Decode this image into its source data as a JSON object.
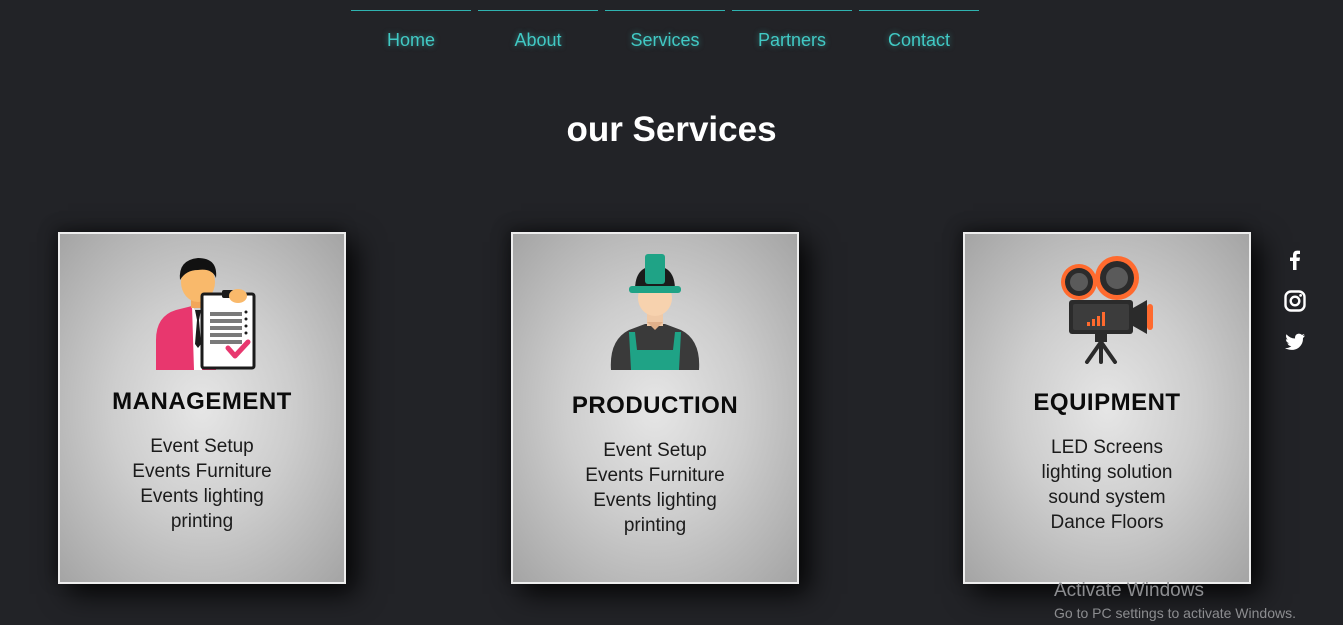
{
  "nav": {
    "items": [
      "Home",
      "About",
      "Services",
      "Partners",
      "Contact"
    ]
  },
  "page_title": "our Services",
  "cards": [
    {
      "icon": "manager-icon",
      "heading": "MANAGEMENT",
      "items": [
        "Event Setup",
        "Events Furniture",
        "Events lighting",
        "printing"
      ]
    },
    {
      "icon": "worker-icon",
      "heading": "PRODUCTION",
      "items": [
        "Event Setup",
        "Events Furniture",
        "Events lighting",
        "printing"
      ]
    },
    {
      "icon": "video-camera-icon",
      "heading": "EQUIPMENT",
      "items": [
        "LED Screens",
        "lighting solution",
        "sound system",
        "Dance Floors"
      ]
    }
  ],
  "social": [
    "facebook-icon",
    "instagram-icon",
    "twitter-icon"
  ],
  "watermark": {
    "title": "Activate Windows",
    "subtitle": "Go to PC settings to activate Windows."
  },
  "colors": {
    "background": "#222327",
    "nav_accent": "#41c9c4",
    "card_text": "#111111"
  }
}
